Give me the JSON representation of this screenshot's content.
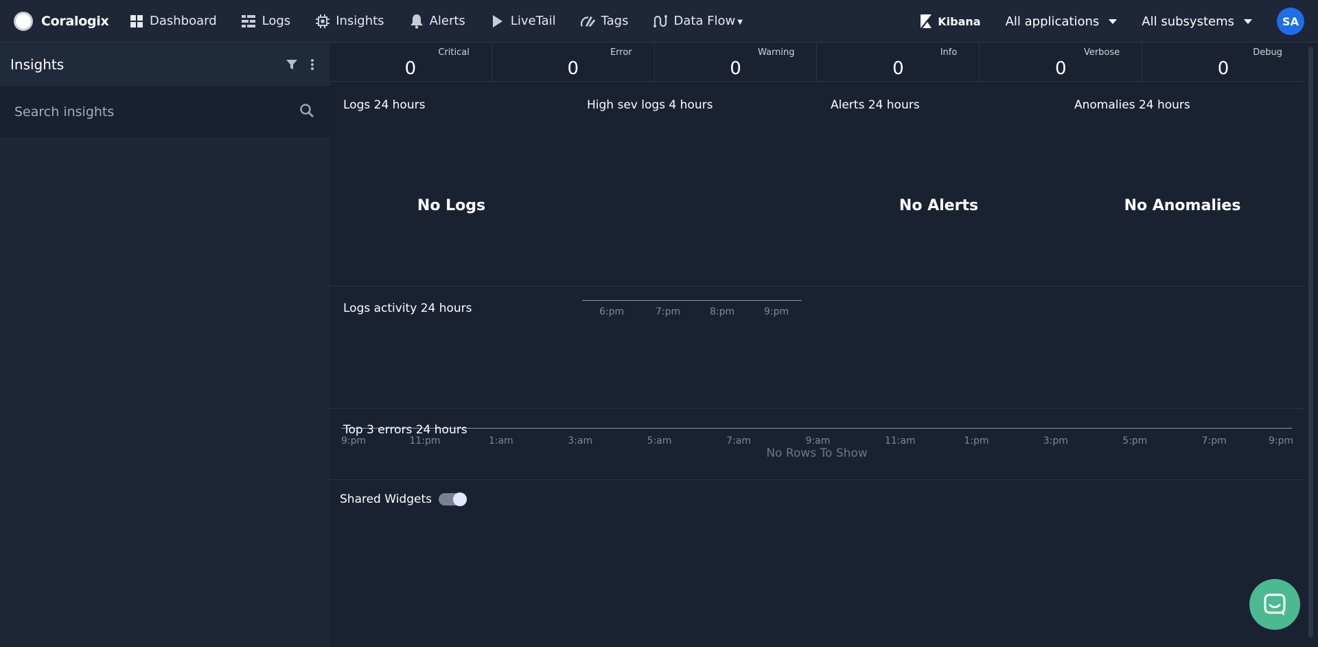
{
  "brand": {
    "name": "Coralogix"
  },
  "nav": {
    "items": [
      {
        "label": "Dashboard",
        "icon": "dashboard-icon"
      },
      {
        "label": "Logs",
        "icon": "logs-icon"
      },
      {
        "label": "Insights",
        "icon": "insights-icon"
      },
      {
        "label": "Alerts",
        "icon": "bell-icon"
      },
      {
        "label": "LiveTail",
        "icon": "play-icon"
      },
      {
        "label": "Tags",
        "icon": "tags-icon"
      },
      {
        "label": "Data Flow",
        "icon": "data-flow-icon"
      }
    ],
    "kibana_label": "Kibana",
    "applications_label": "All applications",
    "subsystems_label": "All subsystems",
    "avatar_initials": "SA"
  },
  "sidebar": {
    "title": "Insights",
    "search_placeholder": "Search insights"
  },
  "severity": [
    {
      "label": "Critical",
      "count": "0"
    },
    {
      "label": "Error",
      "count": "0"
    },
    {
      "label": "Warning",
      "count": "0"
    },
    {
      "label": "Info",
      "count": "0"
    },
    {
      "label": "Verbose",
      "count": "0"
    },
    {
      "label": "Debug",
      "count": "0"
    }
  ],
  "widgets": {
    "logs24": {
      "title": "Logs 24 hours",
      "empty": "No Logs"
    },
    "highsev": {
      "title": "High sev logs 4 hours",
      "ticks": [
        "6:pm",
        "7:pm",
        "8:pm",
        "9:pm"
      ]
    },
    "alerts24": {
      "title": "Alerts 24 hours",
      "empty": "No Alerts"
    },
    "anomalies24": {
      "title": "Anomalies 24 hours",
      "empty": "No Anomalies"
    }
  },
  "activity": {
    "title": "Logs activity 24 hours",
    "ticks": [
      "9:pm",
      "11:pm",
      "1:am",
      "3:am",
      "5:am",
      "7:am",
      "9:am",
      "11:am",
      "1:pm",
      "3:pm",
      "5:pm",
      "7:pm",
      "9:pm"
    ]
  },
  "top_errors": {
    "title": "Top 3 errors 24 hours",
    "empty": "No Rows To Show"
  },
  "shared_widgets": {
    "label": "Shared Widgets",
    "enabled": true
  },
  "colors": {
    "accent": "#1c6fe8",
    "chat": "#4cba90",
    "background": "#1a2232"
  }
}
